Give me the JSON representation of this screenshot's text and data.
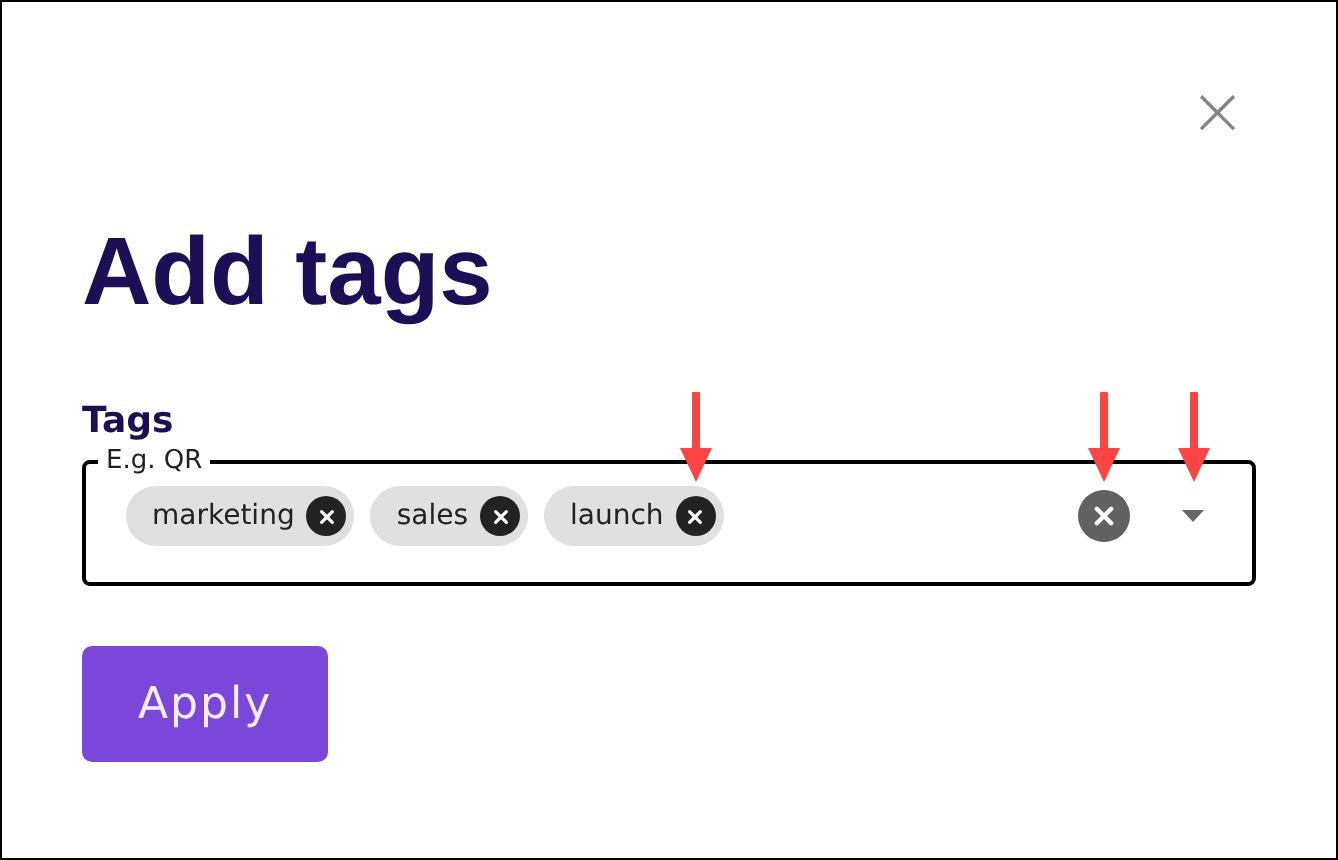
{
  "dialog": {
    "close": "×",
    "title": "Add tags"
  },
  "field": {
    "label": "Tags",
    "placeholder": "E.g. QR",
    "tags": [
      {
        "label": "marketing"
      },
      {
        "label": "sales"
      },
      {
        "label": "launch"
      }
    ]
  },
  "annotation_arrows": [
    {
      "kind": "last_tag_remove"
    },
    {
      "kind": "clear"
    },
    {
      "kind": "dropdown"
    }
  ],
  "apply": "Apply"
}
